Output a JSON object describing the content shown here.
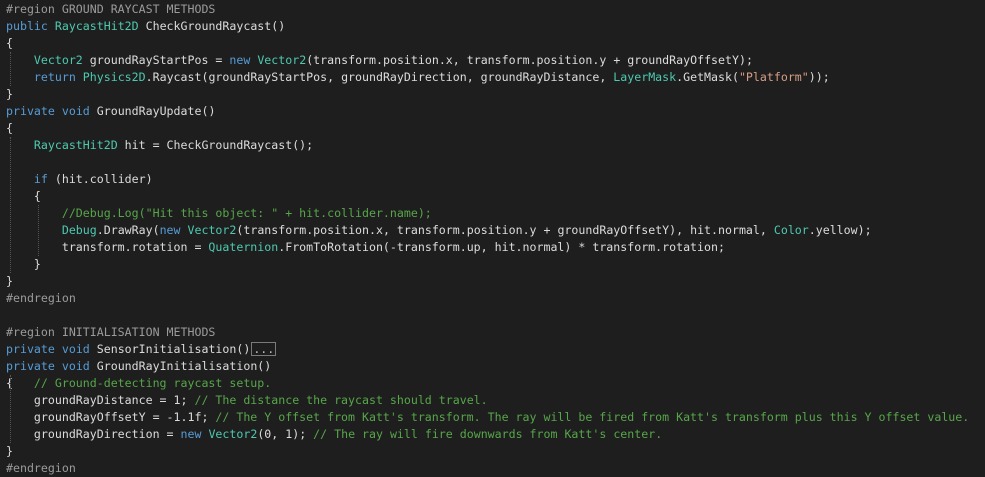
{
  "editor": {
    "colors": {
      "background": "#1e1e1e",
      "text": "#dcdcdc",
      "keyword": "#569cd6",
      "type": "#4ec9b0",
      "string": "#d69d85",
      "comment": "#57a64a",
      "preprocessor": "#9b9b9b"
    },
    "lines": [
      [
        {
          "c": "pp",
          "t": "#region GROUND RAYCAST METHODS"
        }
      ],
      [
        {
          "c": "kw",
          "t": "public"
        },
        {
          "c": "",
          "t": " "
        },
        {
          "c": "ty",
          "t": "RaycastHit2D"
        },
        {
          "c": "",
          "t": " CheckGroundRaycast()"
        }
      ],
      [
        {
          "c": "",
          "t": "{"
        }
      ],
      [
        {
          "c": "",
          "t": "    "
        },
        {
          "c": "ty",
          "t": "Vector2"
        },
        {
          "c": "",
          "t": " groundRayStartPos = "
        },
        {
          "c": "kw",
          "t": "new"
        },
        {
          "c": "",
          "t": " "
        },
        {
          "c": "ty",
          "t": "Vector2"
        },
        {
          "c": "",
          "t": "(transform.position.x, transform.position.y + groundRayOffsetY);"
        }
      ],
      [
        {
          "c": "",
          "t": "    "
        },
        {
          "c": "kw",
          "t": "return"
        },
        {
          "c": "",
          "t": " "
        },
        {
          "c": "ty",
          "t": "Physics2D"
        },
        {
          "c": "",
          "t": ".Raycast(groundRayStartPos, groundRayDirection, groundRayDistance, "
        },
        {
          "c": "ty",
          "t": "LayerMask"
        },
        {
          "c": "",
          "t": ".GetMask("
        },
        {
          "c": "st",
          "t": "\"Platform\""
        },
        {
          "c": "",
          "t": "));"
        }
      ],
      [
        {
          "c": "",
          "t": "}"
        }
      ],
      [
        {
          "c": "kw",
          "t": "private"
        },
        {
          "c": "",
          "t": " "
        },
        {
          "c": "kw",
          "t": "void"
        },
        {
          "c": "",
          "t": " GroundRayUpdate()"
        }
      ],
      [
        {
          "c": "",
          "t": "{"
        }
      ],
      [
        {
          "c": "",
          "t": "    "
        },
        {
          "c": "ty",
          "t": "RaycastHit2D"
        },
        {
          "c": "",
          "t": " hit = CheckGroundRaycast();"
        }
      ],
      [
        {
          "c": "",
          "t": ""
        }
      ],
      [
        {
          "c": "",
          "t": "    "
        },
        {
          "c": "kw",
          "t": "if"
        },
        {
          "c": "",
          "t": " (hit.collider)"
        }
      ],
      [
        {
          "c": "",
          "t": "    {"
        }
      ],
      [
        {
          "c": "",
          "t": "        "
        },
        {
          "c": "cm",
          "t": "//Debug.Log(\"Hit this object: \" + hit.collider.name);"
        }
      ],
      [
        {
          "c": "",
          "t": "        "
        },
        {
          "c": "ty",
          "t": "Debug"
        },
        {
          "c": "",
          "t": ".DrawRay("
        },
        {
          "c": "kw",
          "t": "new"
        },
        {
          "c": "",
          "t": " "
        },
        {
          "c": "ty",
          "t": "Vector2"
        },
        {
          "c": "",
          "t": "(transform.position.x, transform.position.y + groundRayOffsetY), hit.normal, "
        },
        {
          "c": "ty",
          "t": "Color"
        },
        {
          "c": "",
          "t": ".yellow);"
        }
      ],
      [
        {
          "c": "",
          "t": "        transform.rotation = "
        },
        {
          "c": "ty",
          "t": "Quaternion"
        },
        {
          "c": "",
          "t": ".FromToRotation(-transform.up, hit.normal) * transform.rotation;"
        }
      ],
      [
        {
          "c": "",
          "t": "    }"
        }
      ],
      [
        {
          "c": "",
          "t": "}"
        }
      ],
      [
        {
          "c": "pp",
          "t": "#endregion"
        }
      ],
      [
        {
          "c": "",
          "t": ""
        }
      ],
      [
        {
          "c": "pp",
          "t": "#region INITIALISATION METHODS"
        }
      ],
      [
        {
          "c": "kw",
          "t": "private"
        },
        {
          "c": "",
          "t": " "
        },
        {
          "c": "kw",
          "t": "void"
        },
        {
          "c": "",
          "t": " SensorInitialisation()"
        },
        {
          "c": "fold",
          "t": "..."
        }
      ],
      [
        {
          "c": "kw",
          "t": "private"
        },
        {
          "c": "",
          "t": " "
        },
        {
          "c": "kw",
          "t": "void"
        },
        {
          "c": "",
          "t": " GroundRayInitialisation()"
        }
      ],
      [
        {
          "c": "",
          "t": "{   "
        },
        {
          "c": "cm",
          "t": "// Ground-detecting raycast setup."
        }
      ],
      [
        {
          "c": "",
          "t": "    groundRayDistance = 1; "
        },
        {
          "c": "cm",
          "t": "// The distance the raycast should travel."
        }
      ],
      [
        {
          "c": "",
          "t": "    groundRayOffsetY = -1.1f; "
        },
        {
          "c": "cm",
          "t": "// The Y offset from Katt's transform. The ray will be fired from Katt's transform plus this Y offset value."
        }
      ],
      [
        {
          "c": "",
          "t": "    groundRayDirection = "
        },
        {
          "c": "kw",
          "t": "new"
        },
        {
          "c": "",
          "t": " "
        },
        {
          "c": "ty",
          "t": "Vector2"
        },
        {
          "c": "",
          "t": "(0, 1); "
        },
        {
          "c": "cm",
          "t": "// The ray will fire downwards from Katt's center."
        }
      ],
      [
        {
          "c": "",
          "t": "}"
        }
      ],
      [
        {
          "c": "pp",
          "t": "#endregion"
        }
      ]
    ]
  }
}
